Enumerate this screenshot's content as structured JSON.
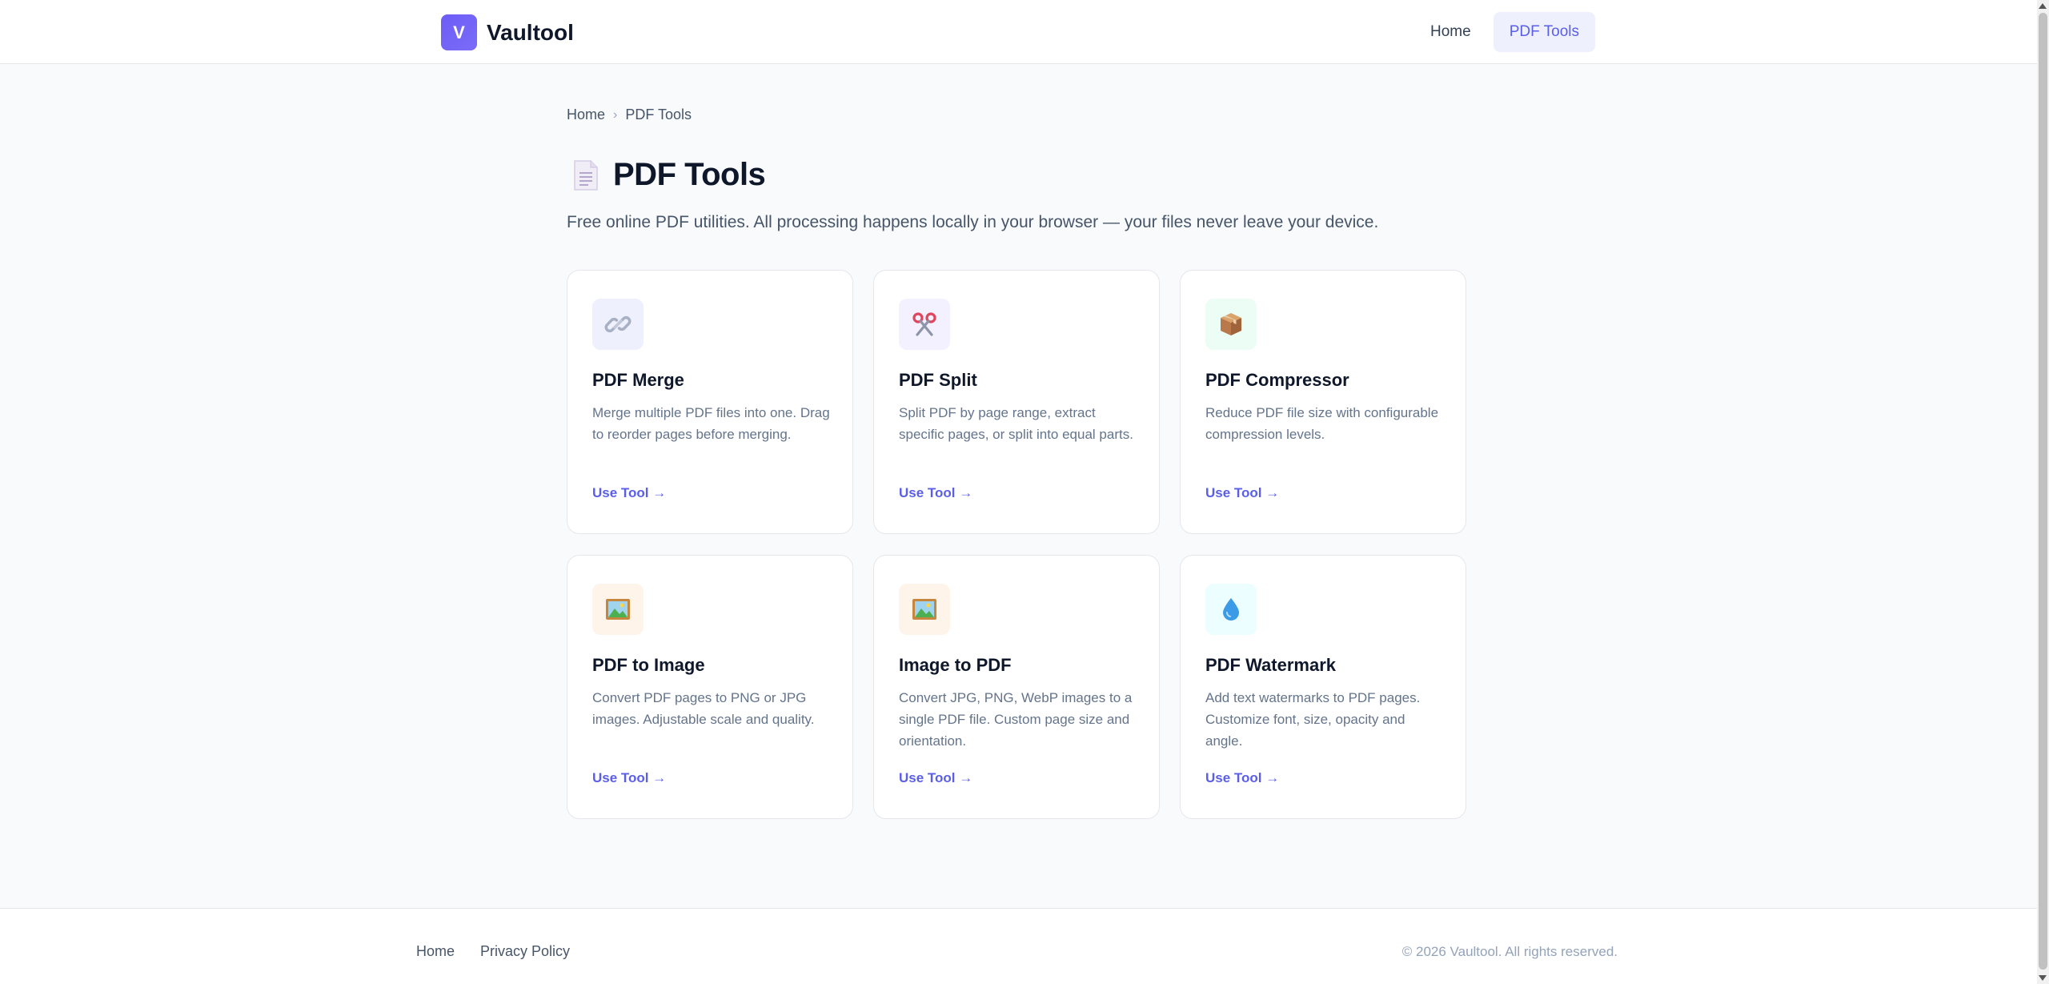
{
  "header": {
    "logo_letter": "V",
    "brand_name": "Vaultool",
    "nav": [
      {
        "label": "Home",
        "active": false
      },
      {
        "label": "PDF Tools",
        "active": true
      }
    ]
  },
  "breadcrumb": {
    "items": [
      "Home",
      "PDF Tools"
    ],
    "separator": "›"
  },
  "page": {
    "title_icon": "page-facing-up-icon",
    "title": "PDF Tools",
    "subtitle": "Free online PDF utilities. All processing happens locally in your browser — your files never leave your device."
  },
  "tools": [
    {
      "icon": "link-icon",
      "icon_bg": "#eef0fe",
      "title": "PDF Merge",
      "description": "Merge multiple PDF files into one. Drag to reorder pages before merging.",
      "link": "Use Tool →"
    },
    {
      "icon": "scissors-icon",
      "icon_bg": "#f3f0ff",
      "title": "PDF Split",
      "description": "Split PDF by page range, extract specific pages, or split into equal parts.",
      "link": "Use Tool →"
    },
    {
      "icon": "package-icon",
      "icon_bg": "#ecfdf5",
      "title": "PDF Compressor",
      "description": "Reduce PDF file size with configurable compression levels.",
      "link": "Use Tool →"
    },
    {
      "icon": "framed-picture-icon",
      "icon_bg": "#fff4ea",
      "title": "PDF to Image",
      "description": "Convert PDF pages to PNG or JPG images. Adjustable scale and quality.",
      "link": "Use Tool →"
    },
    {
      "icon": "framed-picture-icon",
      "icon_bg": "#fff4ea",
      "title": "Image to PDF",
      "description": "Convert JPG, PNG, WebP images to a single PDF file. Custom page size and orientation.",
      "link": "Use Tool →"
    },
    {
      "icon": "droplet-icon",
      "icon_bg": "#ecfeff",
      "title": "PDF Watermark",
      "description": "Add text watermarks to PDF pages. Customize font, size, opacity and angle.",
      "link": "Use Tool →"
    }
  ],
  "footer": {
    "links": [
      "Home",
      "Privacy Policy"
    ],
    "copyright": "© 2026 Vaultool. All rights reserved."
  },
  "colors": {
    "accent": "#5b5fe8",
    "logo": "#6d5df6",
    "background": "#f8fafc"
  }
}
